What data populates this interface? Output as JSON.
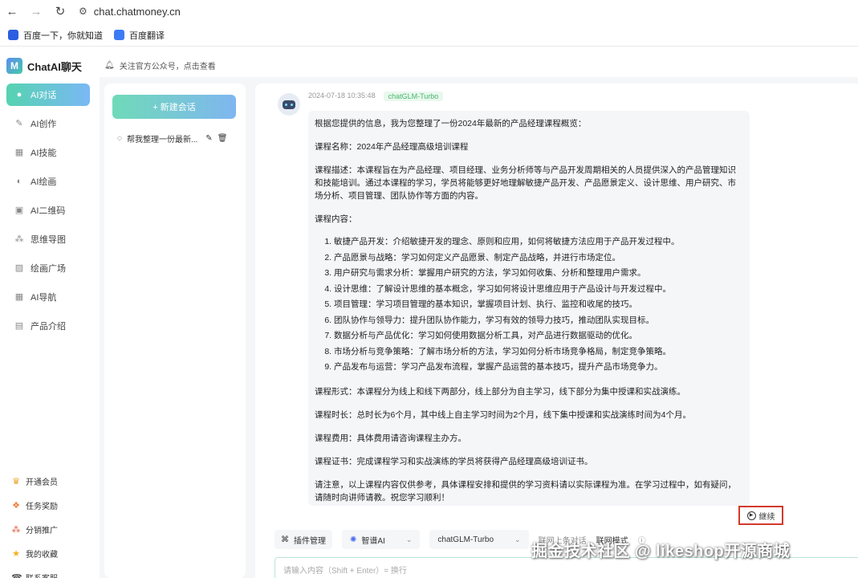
{
  "browser": {
    "url": "chat.chatmoney.cn",
    "bookmarks": [
      "百度一下，你就知道",
      "百度翻译"
    ]
  },
  "app": {
    "name": "ChatAI聊天",
    "menu": [
      {
        "label": "AI对话",
        "icon": "chat-icon",
        "active": true
      },
      {
        "label": "AI创作",
        "icon": "pen-icon",
        "active": false
      },
      {
        "label": "AI技能",
        "icon": "grid-icon",
        "active": false
      },
      {
        "label": "AI绘画",
        "icon": "palette-icon",
        "active": false
      },
      {
        "label": "AI二维码",
        "icon": "qrcode-icon",
        "active": false
      },
      {
        "label": "思维导图",
        "icon": "mindmap-icon",
        "active": false
      },
      {
        "label": "绘画广场",
        "icon": "image-icon",
        "active": false
      },
      {
        "label": "AI导航",
        "icon": "apps-icon",
        "active": false
      },
      {
        "label": "产品介绍",
        "icon": "doc-icon",
        "active": false
      }
    ],
    "bottom_menu": [
      {
        "label": "开通会员",
        "icon": "vip-icon"
      },
      {
        "label": "任务奖励",
        "icon": "reward-icon"
      },
      {
        "label": "分销推广",
        "icon": "share-icon"
      },
      {
        "label": "我的收藏",
        "icon": "star-icon"
      },
      {
        "label": "联系客服",
        "icon": "service-icon"
      }
    ]
  },
  "notice": "关注官方公众号，点击查看",
  "conversations": {
    "new_label": "+ 新建会话",
    "items": [
      {
        "title": "帮我整理一份最新..."
      }
    ]
  },
  "message": {
    "timestamp": "2024-07-18 10:35:48",
    "model": "chatGLM-Turbo",
    "intro": "根据您提供的信息，我为您整理了一份2024年最新的产品经理课程概览：",
    "course_name": "课程名称：2024年产品经理高级培训课程",
    "description": "课程描述：本课程旨在为产品经理、项目经理、业务分析师等与产品开发周期相关的人员提供深入的产品管理知识和技能培训。通过本课程的学习，学员将能够更好地理解敏捷产品开发、产品愿景定义、设计思维、用户研究、市场分析、项目管理、团队协作等方面的内容。",
    "content_title": "课程内容：",
    "content_items": [
      "敏捷产品开发：介绍敏捷开发的理念、原则和应用，如何将敏捷方法应用于产品开发过程中。",
      "产品愿景与战略：学习如何定义产品愿景、制定产品战略，并进行市场定位。",
      "用户研究与需求分析：掌握用户研究的方法，学习如何收集、分析和整理用户需求。",
      "设计思维：了解设计思维的基本概念，学习如何将设计思维应用于产品设计与开发过程中。",
      "项目管理：学习项目管理的基本知识，掌握项目计划、执行、监控和收尾的技巧。",
      "团队协作与领导力：提升团队协作能力，学习有效的领导力技巧，推动团队实现目标。",
      "数据分析与产品优化：学习如何使用数据分析工具，对产品进行数据驱动的优化。",
      "市场分析与竞争策略：了解市场分析的方法，学习如何分析市场竞争格局，制定竞争策略。",
      "产品发布与运营：学习产品发布流程，掌握产品运营的基本技巧，提升产品市场竞争力。"
    ],
    "format": "课程形式：本课程分为线上和线下两部分，线上部分为自主学习，线下部分为集中授课和实战演练。",
    "duration": "课程时长：总时长为6个月，其中线上自主学习时间为2个月，线下集中授课和实战演练时间为4个月。",
    "fee": "课程费用：具体费用请咨询课程主办方。",
    "certificate": "课程证书：完成课程学习和实战演练的学员将获得产品经理高级培训证书。",
    "note": "请注意，以上课程内容仅供参考，具体课程安排和提供的学习资料请以实际课程为准。在学习过程中，如有疑问，请随时向讲师请教。祝您学习顺利！"
  },
  "continue_label": "继续",
  "toolbar": {
    "plugin_label": "插件管理",
    "assistant": "智谱AI",
    "model": "chatGLM-Turbo",
    "context_label": "联网上条对话",
    "mode_label": "联网模式"
  },
  "input": {
    "placeholder": "请输入内容（Shift + Enter）= 换行"
  },
  "watermark": "掘金技术社区 @ likeshop开源商城",
  "colors": {
    "accent_start": "#56d3b0",
    "accent_end": "#7ab8f5",
    "highlight_border": "#d33a2c",
    "model_badge": "#46b86c"
  }
}
